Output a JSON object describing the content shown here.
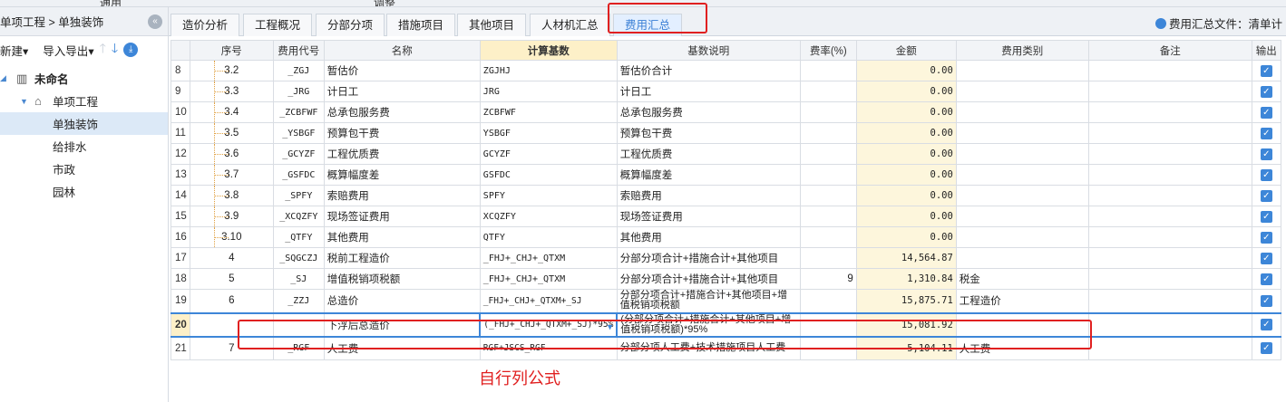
{
  "topbar": {
    "left": "通用",
    "mid": "调整"
  },
  "sidebar": {
    "breadcrumb": "单项工程 > 单独装饰",
    "tools": {
      "new": "新建",
      "import_export": "导入导出"
    },
    "tree": {
      "root": "未命名",
      "project": "单项工程",
      "children": [
        "单独装饰",
        "给排水",
        "市政",
        "园林"
      ]
    }
  },
  "tabs": [
    "造价分析",
    "工程概况",
    "分部分项",
    "措施项目",
    "其他项目",
    "人材机汇总",
    "费用汇总"
  ],
  "summary_file": "费用汇总文件：清单计",
  "table": {
    "headers": {
      "seq": "序号",
      "code": "费用代号",
      "name": "名称",
      "base": "计算基数",
      "desc": "基数说明",
      "rate": "费率(%)",
      "amount": "金额",
      "category": "费用类别",
      "remark": "备注",
      "output": "输出"
    },
    "rows": [
      {
        "n": "8",
        "seq": "3.2",
        "code": "_ZGJ",
        "name": "暂估价",
        "base": "ZGJHJ",
        "desc": "暂估价合计",
        "rate": "",
        "amount": "0.00",
        "category": "",
        "remark": ""
      },
      {
        "n": "9",
        "seq": "3.3",
        "code": "_JRG",
        "name": "计日工",
        "base": "JRG",
        "desc": "计日工",
        "rate": "",
        "amount": "0.00",
        "category": "",
        "remark": ""
      },
      {
        "n": "10",
        "seq": "3.4",
        "code": "_ZCBFWF",
        "name": "总承包服务费",
        "base": "ZCBFWF",
        "desc": "总承包服务费",
        "rate": "",
        "amount": "0.00",
        "category": "",
        "remark": ""
      },
      {
        "n": "11",
        "seq": "3.5",
        "code": "_YSBGF",
        "name": "预算包干费",
        "base": "YSBGF",
        "desc": "预算包干费",
        "rate": "",
        "amount": "0.00",
        "category": "",
        "remark": ""
      },
      {
        "n": "12",
        "seq": "3.6",
        "code": "_GCYZF",
        "name": "工程优质费",
        "base": "GCYZF",
        "desc": "工程优质费",
        "rate": "",
        "amount": "0.00",
        "category": "",
        "remark": ""
      },
      {
        "n": "13",
        "seq": "3.7",
        "code": "_GSFDC",
        "name": "概算幅度差",
        "base": "GSFDC",
        "desc": "概算幅度差",
        "rate": "",
        "amount": "0.00",
        "category": "",
        "remark": ""
      },
      {
        "n": "14",
        "seq": "3.8",
        "code": "_SPFY",
        "name": "索赔费用",
        "base": "SPFY",
        "desc": "索赔费用",
        "rate": "",
        "amount": "0.00",
        "category": "",
        "remark": ""
      },
      {
        "n": "15",
        "seq": "3.9",
        "code": "_XCQZFY",
        "name": "现场签证费用",
        "base": "XCQZFY",
        "desc": "现场签证费用",
        "rate": "",
        "amount": "0.00",
        "category": "",
        "remark": ""
      },
      {
        "n": "16",
        "seq": "3.10",
        "code": "_QTFY",
        "name": "其他费用",
        "base": "QTFY",
        "desc": "其他费用",
        "rate": "",
        "amount": "0.00",
        "category": "",
        "remark": ""
      },
      {
        "n": "17",
        "seq": "4",
        "code": "_SQGCZJ",
        "name": "税前工程造价",
        "base": "_FHJ+_CHJ+_QTXM",
        "desc": "分部分项合计+措施合计+其他项目",
        "rate": "",
        "amount": "14,564.87",
        "category": "",
        "remark": ""
      },
      {
        "n": "18",
        "seq": "5",
        "code": "_SJ",
        "name": "增值税销项税额",
        "base": "_FHJ+_CHJ+_QTXM",
        "desc": "分部分项合计+措施合计+其他项目",
        "rate": "9",
        "amount": "1,310.84",
        "category": "税金",
        "remark": ""
      },
      {
        "n": "19",
        "seq": "6",
        "code": "_ZZJ",
        "name": "总造价",
        "base": "_FHJ+_CHJ+_QTXM+_SJ",
        "desc": "分部分项合计+措施合计+其他项目+增值税销项税额",
        "rate": "",
        "amount": "15,875.71",
        "category": "工程造价",
        "remark": ""
      },
      {
        "n": "20",
        "seq": "",
        "code": "",
        "name": "下浮后总造价",
        "base": "(_FHJ+_CHJ+_QTXM+_SJ)*95%",
        "desc": "(分部分项合计+措施合计+其他项目+增值税销项税额)*95%",
        "rate": "",
        "amount": "15,081.92",
        "category": "",
        "remark": ""
      },
      {
        "n": "21",
        "seq": "7",
        "code": "_RGF",
        "name": "人工费",
        "base": "RGF+JSCS_RGF",
        "desc": "分部分项人工费+技术措施项目人工费",
        "rate": "",
        "amount": "5,104.11",
        "category": "人工费",
        "remark": ""
      }
    ]
  },
  "annotation": "自行列公式",
  "colors": {
    "accent": "#3d86d8",
    "highlight_box": "#e02020",
    "amount_bg": "#fdf6dc"
  }
}
